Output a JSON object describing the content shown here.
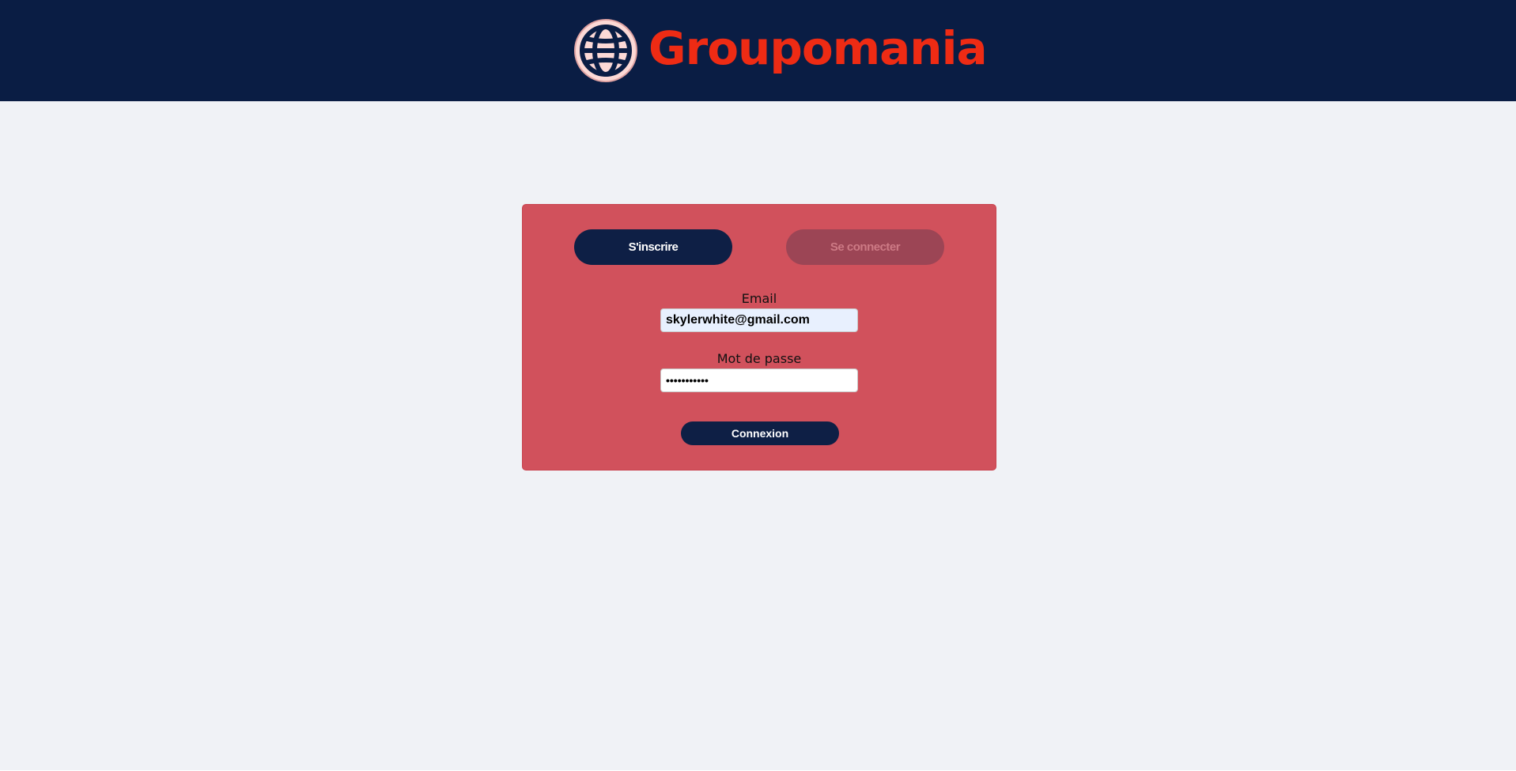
{
  "header": {
    "brand_name": "Groupomania",
    "logo_icon": "globe-icon",
    "colors": {
      "background": "#0a1d44",
      "brand": "#ee2b14",
      "logo_fill": "#fcd9d6"
    }
  },
  "auth_card": {
    "tabs": {
      "signup_label": "S'inscrire",
      "login_label": "Se connecter"
    },
    "email": {
      "label": "Email",
      "value": "skylerwhite@gmail.com"
    },
    "password": {
      "label": "Mot de passe",
      "value": "•••••••••••"
    },
    "submit_label": "Connexion",
    "colors": {
      "card": "#d1515c",
      "primary_button": "#0e1f45"
    }
  }
}
